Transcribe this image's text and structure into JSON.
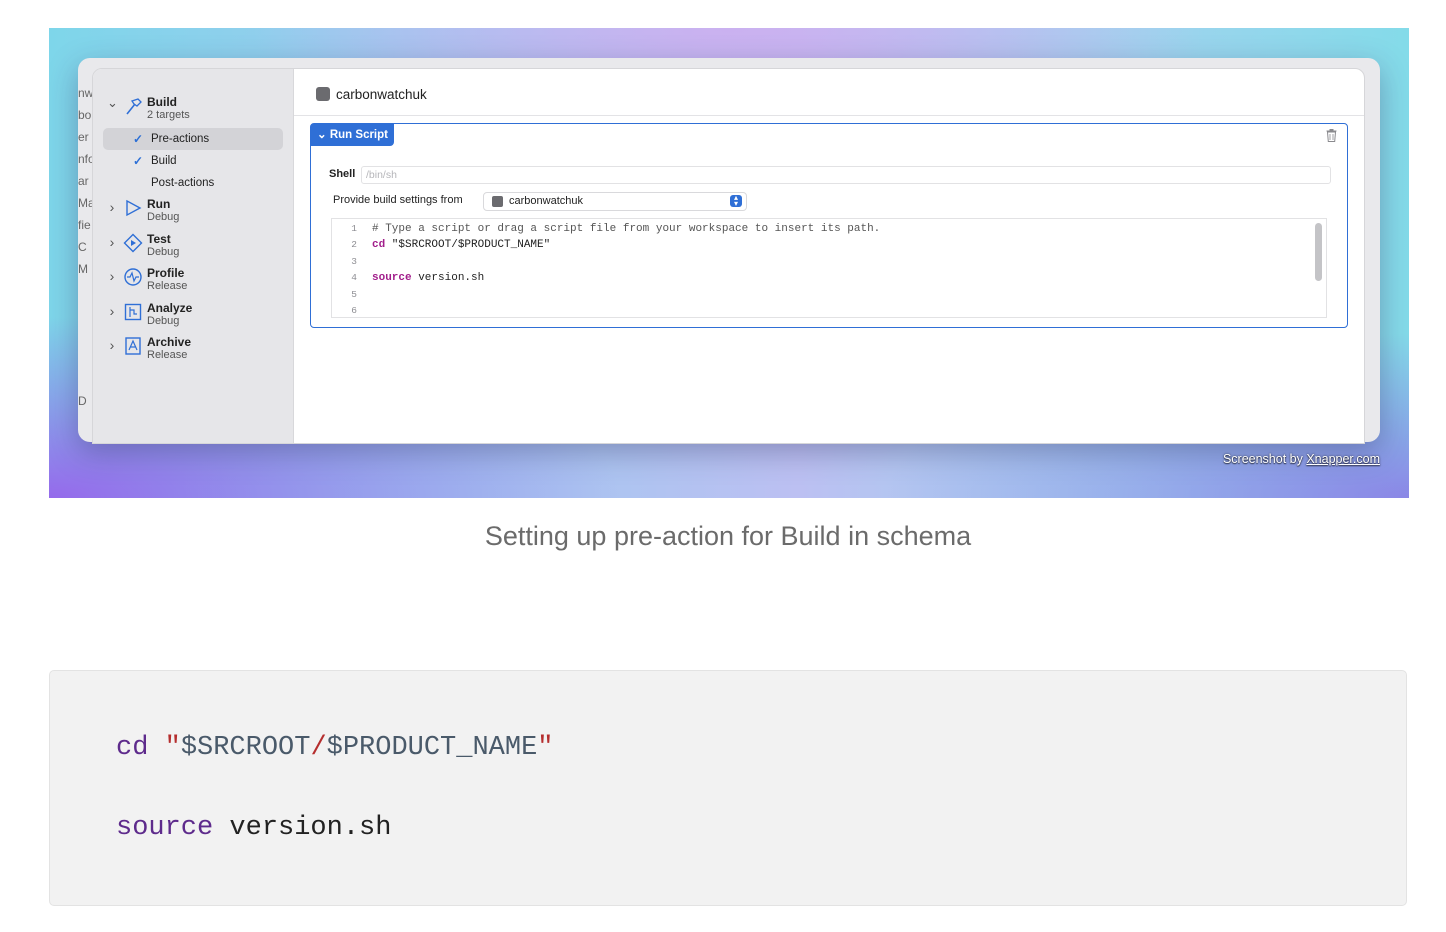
{
  "hero": {
    "bg_strip_letters": [
      "nw",
      "bo",
      "er",
      "nfo",
      "ar",
      "Mai",
      "fie",
      "C",
      "M",
      "",
      "",
      "",
      "",
      "",
      "D"
    ],
    "sidebar": {
      "actions": [
        {
          "name": "Build",
          "sub": "2 targets",
          "icon": "hammer-icon",
          "expanded": true
        },
        {
          "name": "Run",
          "sub": "Debug",
          "icon": "play-icon",
          "expanded": false
        },
        {
          "name": "Test",
          "sub": "Debug",
          "icon": "diamond-play-icon",
          "expanded": false
        },
        {
          "name": "Profile",
          "sub": "Release",
          "icon": "gauge-icon",
          "expanded": false
        },
        {
          "name": "Analyze",
          "sub": "Debug",
          "icon": "analyze-icon",
          "expanded": false
        },
        {
          "name": "Archive",
          "sub": "Release",
          "icon": "archive-icon",
          "expanded": false
        }
      ],
      "build_children": [
        {
          "label": "Pre-actions",
          "checked": true,
          "selected": true
        },
        {
          "label": "Build",
          "checked": true,
          "selected": false
        },
        {
          "label": "Post-actions",
          "checked": false,
          "selected": false
        }
      ],
      "check_glyph": "✓",
      "chevron_down": "⌄",
      "chevron_right": "›"
    },
    "content": {
      "title": "carbonwatchuk",
      "run_script_label": "Run Script",
      "run_script_chevron": "⌄",
      "shell_label": "Shell",
      "shell_placeholder": "/bin/sh",
      "provide_label": "Provide build settings from",
      "provide_value": "carbonwatchuk",
      "editor_lines": [
        {
          "n": "1",
          "parts": [
            {
              "t": "# Type a script or drag a script file from your workspace to insert its path.",
              "c": "cm"
            }
          ]
        },
        {
          "n": "2",
          "parts": [
            {
              "t": "cd",
              "c": "kw"
            },
            {
              "t": " \"$SRCROOT/$PRODUCT_NAME\"",
              "c": ""
            }
          ]
        },
        {
          "n": "3",
          "parts": []
        },
        {
          "n": "4",
          "parts": [
            {
              "t": "source",
              "c": "kw"
            },
            {
              "t": " version.sh",
              "c": ""
            }
          ]
        },
        {
          "n": "5",
          "parts": []
        },
        {
          "n": "6",
          "parts": []
        }
      ]
    },
    "credit_prefix": "Screenshot by ",
    "credit_link": "Xnapper.com",
    "accent": "#2f6fd6"
  },
  "caption": "Setting up pre-action for Build in schema",
  "codeblock": {
    "line1": {
      "cmd": "cd",
      "q1": "\"",
      "var1": "$SRCROOT",
      "slash": "/",
      "var2": "$PRODUCT_NAME",
      "q2": "\""
    },
    "line2": {
      "cmd": "source",
      "arg": "version.sh"
    }
  }
}
